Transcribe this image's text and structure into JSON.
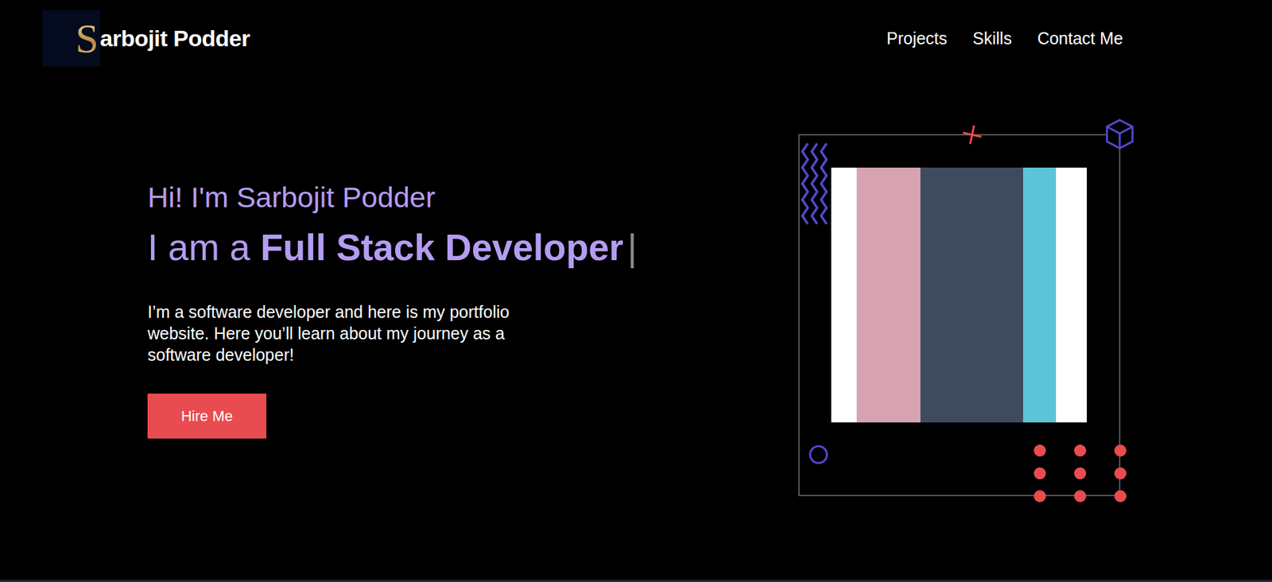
{
  "header": {
    "logo_letter": "S",
    "logo_rest": "arbojit Podder",
    "nav": [
      {
        "label": "Projects"
      },
      {
        "label": "Skills"
      },
      {
        "label": "Contact Me"
      }
    ]
  },
  "hero": {
    "greeting": "Hi! I'm Sarbojit Podder",
    "role_prefix": "I am a",
    "role": "Full Stack Developer",
    "cursor": "|",
    "description": "I’m a software developer and here is my portfolio website. Here you’ll learn about my journey as a software developer!",
    "button": "Hire Me"
  }
}
